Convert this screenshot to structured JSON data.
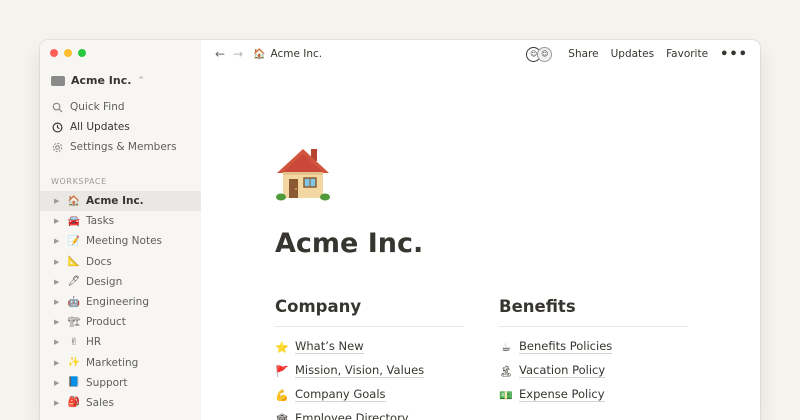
{
  "window": {
    "traffic_colors": [
      "#ff5f57",
      "#febc2e",
      "#28c840"
    ]
  },
  "sidebar": {
    "workspace_name": "Acme Inc.",
    "nav": [
      {
        "label": "Quick Find",
        "icon": "search-icon"
      },
      {
        "label": "All Updates",
        "icon": "clock-icon"
      },
      {
        "label": "Settings & Members",
        "icon": "gear-icon"
      }
    ],
    "section_label": "WORKSPACE",
    "pages": [
      {
        "label": "Acme Inc.",
        "icon": "house-icon"
      },
      {
        "label": "Tasks",
        "icon": "car-icon"
      },
      {
        "label": "Meeting Notes",
        "icon": "memo-icon"
      },
      {
        "label": "Docs",
        "icon": "compass-icon"
      },
      {
        "label": "Design",
        "icon": "pen-icon"
      },
      {
        "label": "Engineering",
        "icon": "robot-icon"
      },
      {
        "label": "Product",
        "icon": "crane-icon"
      },
      {
        "label": "HR",
        "icon": "peace-hand-icon"
      },
      {
        "label": "Marketing",
        "icon": "sparkles-icon"
      },
      {
        "label": "Support",
        "icon": "book-icon"
      },
      {
        "label": "Sales",
        "icon": "backpack-icon"
      }
    ]
  },
  "topbar": {
    "breadcrumb": "Acme Inc.",
    "share": "Share",
    "updates": "Updates",
    "favorite": "Favorite",
    "more": "•••"
  },
  "page": {
    "title": "Acme Inc.",
    "icon": "house-icon",
    "columns": [
      {
        "heading": "Company",
        "links": [
          {
            "label": "What’s New",
            "icon": "star-icon"
          },
          {
            "label": "Mission, Vision, Values",
            "icon": "flag-icon"
          },
          {
            "label": "Company Goals",
            "icon": "muscle-icon"
          },
          {
            "label": "Employee Directory",
            "icon": "building-icon"
          }
        ]
      },
      {
        "heading": "Benefits",
        "links": [
          {
            "label": "Benefits Policies",
            "icon": "coffee-icon"
          },
          {
            "label": "Vacation Policy",
            "icon": "island-icon"
          },
          {
            "label": "Expense Policy",
            "icon": "money-icon"
          }
        ]
      }
    ]
  },
  "colors": {
    "background": "#f7f3ef",
    "sidebar": "#f7f6f3",
    "selected_row": "#e9e8e4",
    "text": "#37352f",
    "muted": "#9b9a97"
  }
}
